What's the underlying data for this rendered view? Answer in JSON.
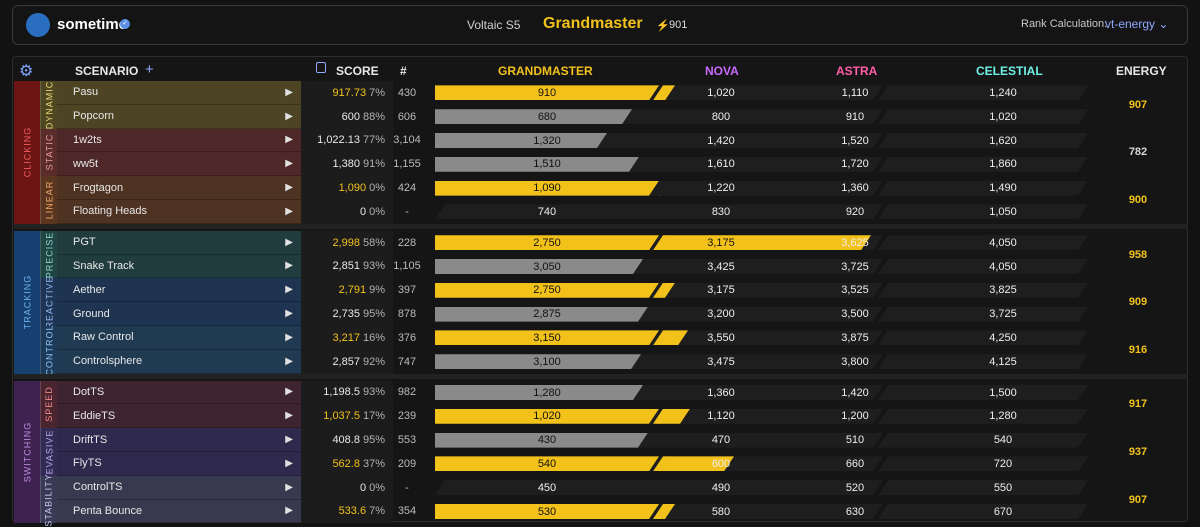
{
  "header": {
    "brand": "sometime",
    "season": "Voltaic S5",
    "rank": "Grandmaster",
    "energy": "901",
    "rank_calc_label": "Rank Calculation:",
    "rank_calc_value": "vt-energy"
  },
  "columns": {
    "scenario": "SCENARIO",
    "score": "SCORE",
    "count": "#",
    "grandmaster": "GRANDMASTER",
    "nova": "NOVA",
    "astra": "ASTRA",
    "celestial": "CELESTIAL",
    "energy": "ENERGY"
  },
  "colors": {
    "gold": "#f2c21b",
    "grey_bar": "#8a8a8a",
    "nova": "#c96bff",
    "astra": "#ff5fa8",
    "celestial": "#6ff0e6",
    "clicking": "#7a1414",
    "tracking": "#1d4e7c",
    "switching": "#4e2d55"
  },
  "groups": [
    {
      "label": "CLICKING",
      "color": "#f25f5f",
      "bg": "#6d1414",
      "subs": [
        {
          "label": "DYNAMIC",
          "color": "#e9d77a",
          "bg": "#4f4722",
          "row_bg": "#4d4424",
          "energy": "907",
          "energy_gold": true,
          "rows": [
            {
              "name": "Pasu",
              "score": "917.73",
              "pct": "7%",
              "gold": true,
              "count": "430",
              "gm": "910",
              "nova": "1,020",
              "astra": "1,110",
              "celestial": "1,240",
              "fill": 1.0,
              "nova_fill": 0.05
            },
            {
              "name": "Popcorn",
              "score": "600",
              "pct": "88%",
              "gold": false,
              "count": "606",
              "gm": "680",
              "nova": "800",
              "astra": "910",
              "celestial": "1,020",
              "fill": 0.88,
              "nova_fill": 0
            }
          ]
        },
        {
          "label": "STATIC",
          "color": "#e99a9a",
          "bg": "#5a2c2c",
          "row_bg": "#4e2828",
          "energy": "782",
          "energy_gold": false,
          "rows": [
            {
              "name": "1w2ts",
              "score": "1,022.13",
              "pct": "77%",
              "gold": false,
              "count": "3,104",
              "gm": "1,320",
              "nova": "1,420",
              "astra": "1,520",
              "celestial": "1,620",
              "fill": 0.77,
              "nova_fill": 0
            },
            {
              "name": "ww5t",
              "score": "1,380",
              "pct": "91%",
              "gold": false,
              "count": "1,155",
              "gm": "1,510",
              "nova": "1,610",
              "astra": "1,720",
              "celestial": "1,860",
              "fill": 0.91,
              "nova_fill": 0
            }
          ]
        },
        {
          "label": "LINEAR",
          "color": "#f0a868",
          "bg": "#5a3520",
          "row_bg": "#4e3222",
          "energy": "900",
          "energy_gold": true,
          "rows": [
            {
              "name": "Frogtagon",
              "score": "1,090",
              "pct": "0%",
              "gold": true,
              "count": "424",
              "gm": "1,090",
              "nova": "1,220",
              "astra": "1,360",
              "celestial": "1,490",
              "fill": 1.0,
              "nova_fill": 0
            },
            {
              "name": "Floating Heads",
              "score": "0",
              "pct": "0%",
              "gold": false,
              "count": "-",
              "gm": "740",
              "nova": "830",
              "astra": "920",
              "celestial": "1,050",
              "fill": 0,
              "nova_fill": 0
            }
          ]
        }
      ]
    },
    {
      "label": "TRACKING",
      "color": "#6fb0ef",
      "bg": "#164070",
      "subs": [
        {
          "label": "PRECISE",
          "color": "#8fd2c8",
          "bg": "#1f4545",
          "row_bg": "#203c3e",
          "energy": "958",
          "energy_gold": true,
          "rows": [
            {
              "name": "PGT",
              "score": "2,998",
              "pct": "58%",
              "gold": true,
              "count": "228",
              "gm": "2,750",
              "nova": "3,175",
              "astra": "3,625",
              "celestial": "4,050",
              "fill": 1.0,
              "nova_fill": 1.0
            },
            {
              "name": "Snake Track",
              "score": "2,851",
              "pct": "93%",
              "gold": false,
              "count": "1,105",
              "gm": "3,050",
              "nova": "3,425",
              "astra": "3,725",
              "celestial": "4,050",
              "fill": 0.93,
              "nova_fill": 0
            }
          ]
        },
        {
          "label": "REACTIVE",
          "color": "#8fb8f0",
          "bg": "#1f3555",
          "row_bg": "#1e3450",
          "energy": "909",
          "energy_gold": true,
          "rows": [
            {
              "name": "Aether",
              "score": "2,791",
              "pct": "9%",
              "gold": true,
              "count": "397",
              "gm": "2,750",
              "nova": "3,175",
              "astra": "3,525",
              "celestial": "3,825",
              "fill": 1.0,
              "nova_fill": 0.09
            },
            {
              "name": "Ground",
              "score": "2,735",
              "pct": "95%",
              "gold": false,
              "count": "878",
              "gm": "2,875",
              "nova": "3,200",
              "astra": "3,500",
              "celestial": "3,725",
              "fill": 0.95,
              "nova_fill": 0
            }
          ]
        },
        {
          "label": "CONTROL",
          "color": "#8ac6f0",
          "bg": "#1d3a5a",
          "row_bg": "#203a52",
          "energy": "916",
          "energy_gold": true,
          "rows": [
            {
              "name": "Raw Control",
              "score": "3,217",
              "pct": "16%",
              "gold": true,
              "count": "376",
              "gm": "3,150",
              "nova": "3,550",
              "astra": "3,875",
              "celestial": "4,250",
              "fill": 1.0,
              "nova_fill": 0.16
            },
            {
              "name": "Controlsphere",
              "score": "2,857",
              "pct": "92%",
              "gold": false,
              "count": "747",
              "gm": "3,100",
              "nova": "3,475",
              "astra": "3,800",
              "celestial": "4,125",
              "fill": 0.92,
              "nova_fill": 0
            }
          ]
        }
      ]
    },
    {
      "label": "SWITCHING",
      "color": "#c08ae0",
      "bg": "#3e2350",
      "subs": [
        {
          "label": "SPEED",
          "color": "#f08888",
          "bg": "#4a2530",
          "row_bg": "#3d2430",
          "energy": "917",
          "energy_gold": true,
          "rows": [
            {
              "name": "DotTS",
              "score": "1,198.5",
              "pct": "93%",
              "gold": false,
              "count": "982",
              "gm": "1,280",
              "nova": "1,360",
              "astra": "1,420",
              "celestial": "1,500",
              "fill": 0.93,
              "nova_fill": 0
            },
            {
              "name": "EddieTS",
              "score": "1,037.5",
              "pct": "17%",
              "gold": true,
              "count": "239",
              "gm": "1,020",
              "nova": "1,120",
              "astra": "1,200",
              "celestial": "1,280",
              "fill": 1.0,
              "nova_fill": 0.17
            }
          ]
        },
        {
          "label": "EVASIVE",
          "color": "#b8a8f0",
          "bg": "#322c55",
          "row_bg": "#30294e",
          "energy": "937",
          "energy_gold": true,
          "rows": [
            {
              "name": "DriftTS",
              "score": "408.8",
              "pct": "95%",
              "gold": false,
              "count": "553",
              "gm": "430",
              "nova": "470",
              "astra": "510",
              "celestial": "540",
              "fill": 0.95,
              "nova_fill": 0
            },
            {
              "name": "FlyTS",
              "score": "562.8",
              "pct": "37%",
              "gold": true,
              "count": "209",
              "gm": "540",
              "nova": "600",
              "astra": "660",
              "celestial": "720",
              "fill": 1.0,
              "nova_fill": 0.37
            }
          ]
        },
        {
          "label": "STABILITY",
          "color": "#c8c8ee",
          "bg": "#3a3a55",
          "row_bg": "#38384e",
          "energy": "907",
          "energy_gold": true,
          "rows": [
            {
              "name": "ControlTS",
              "score": "0",
              "pct": "0%",
              "gold": false,
              "count": "-",
              "gm": "450",
              "nova": "490",
              "astra": "520",
              "celestial": "550",
              "fill": 0,
              "nova_fill": 0
            },
            {
              "name": "Penta Bounce",
              "score": "533.6",
              "pct": "7%",
              "gold": true,
              "count": "354",
              "gm": "530",
              "nova": "580",
              "astra": "630",
              "celestial": "670",
              "fill": 1.0,
              "nova_fill": 0.07
            }
          ]
        }
      ]
    }
  ]
}
